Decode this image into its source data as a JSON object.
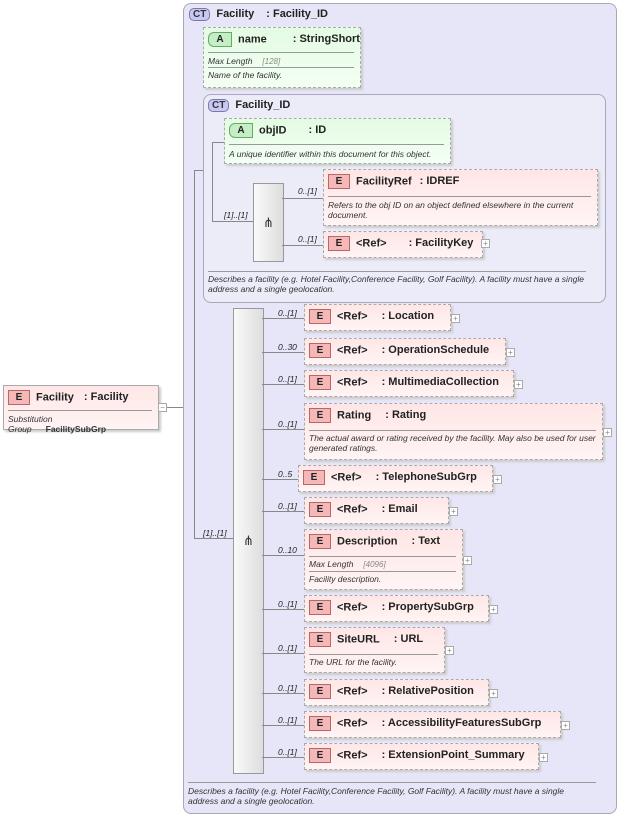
{
  "root": {
    "badge": "E",
    "name": "Facility",
    "type": ": Facility",
    "sub_label": "Substitution Group",
    "sub_value": "FacilitySubGrp"
  },
  "ct": {
    "badge": "CT",
    "name": "Facility",
    "type": ": Facility_ID",
    "description": "Describes a facility (e.g. Hotel Facility,Conference Facility, Golf Facility).  A facility must have a single address and a single geolocation.",
    "seq_mult": "[1]..[1]"
  },
  "name_attr": {
    "badge": "A",
    "name": "name",
    "type": ": StringShort",
    "max_label": "Max Length",
    "max_value": "[128]",
    "description": "Name of the facility."
  },
  "inner_ct": {
    "badge": "CT",
    "name": "Facility_ID",
    "description": "Describes a facility (e.g. Hotel Facility,Conference Facility, Golf Facility).  A facility must have a single address and a single geolocation.",
    "seq_mult": "[1]..[1]",
    "objid": {
      "badge": "A",
      "name": "objID",
      "type": ": ID",
      "description": "A unique identifier within this document for this object."
    },
    "facility_ref": {
      "badge": "E",
      "name": "FacilityRef",
      "type": ": IDREF",
      "mult": "0..[1]",
      "description": "Refers to the obj ID on an object defined elsewhere in the current document."
    },
    "facility_key": {
      "badge": "E",
      "name": "<Ref>",
      "type": ": FacilityKey",
      "mult": "0..[1]"
    }
  },
  "children": [
    {
      "badge": "E",
      "name": "<Ref>",
      "type": ": Location",
      "mult": "0..[1]"
    },
    {
      "badge": "E",
      "name": "<Ref>",
      "type": ": OperationSchedule",
      "mult": "0..30"
    },
    {
      "badge": "E",
      "name": "<Ref>",
      "type": ": MultimediaCollection",
      "mult": "0..[1]"
    },
    {
      "badge": "E",
      "name": "Rating",
      "type": ": Rating",
      "mult": "0..[1]",
      "description": "The actual award or rating received by the facility.  May also be used for user generated ratings."
    },
    {
      "badge": "E",
      "name": "<Ref>",
      "type": ": TelephoneSubGrp",
      "mult": "0..5"
    },
    {
      "badge": "E",
      "name": "<Ref>",
      "type": ": Email",
      "mult": "0..[1]"
    },
    {
      "badge": "E",
      "name": "Description",
      "type": ": Text",
      "mult": "0..10",
      "max_label": "Max Length",
      "max_value": "[4096]",
      "description": "Facility description."
    },
    {
      "badge": "E",
      "name": "<Ref>",
      "type": ": PropertySubGrp",
      "mult": "0..[1]"
    },
    {
      "badge": "E",
      "name": "SiteURL",
      "type": ": URL",
      "mult": "0..[1]",
      "description": "The URL for the facility."
    },
    {
      "badge": "E",
      "name": "<Ref>",
      "type": ": RelativePosition",
      "mult": "0..[1]"
    },
    {
      "badge": "E",
      "name": "<Ref>",
      "type": ": AccessibilityFeaturesSubGrp",
      "mult": "0..[1]"
    },
    {
      "badge": "E",
      "name": "<Ref>",
      "type": ": ExtensionPoint_Summary",
      "mult": "0..[1]"
    }
  ]
}
